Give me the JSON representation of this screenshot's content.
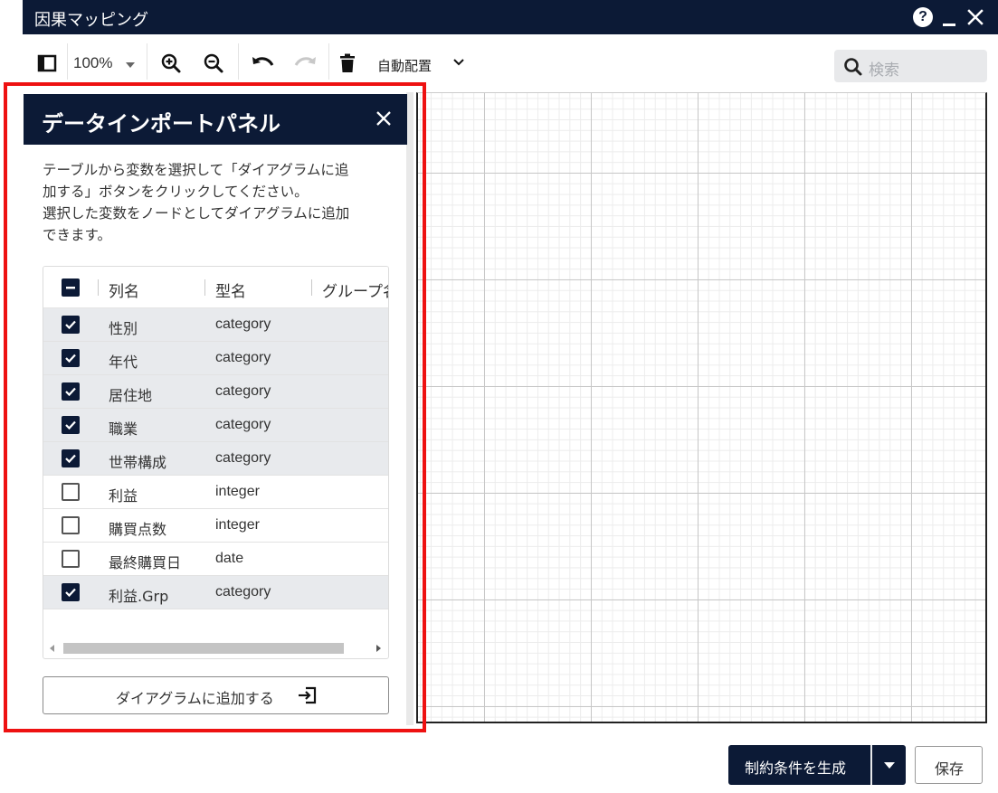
{
  "window": {
    "title": "因果マッピング"
  },
  "toolbar": {
    "zoom_level": "100%",
    "auto_layout_label": "自動配置",
    "search_placeholder": "検索"
  },
  "panel": {
    "title": "データインポートパネル",
    "description": [
      "テーブルから変数を選択して「ダイアグラムに追",
      "加する」ボタンをクリックしてください。",
      "選択した変数をノードとしてダイアグラムに追加",
      "できます。"
    ],
    "columns": [
      "列名",
      "型名",
      "グループ名"
    ],
    "header_checkbox_state": "indeterminate",
    "rows": [
      {
        "name": "性別",
        "type": "category",
        "checked": true
      },
      {
        "name": "年代",
        "type": "category",
        "checked": true
      },
      {
        "name": "居住地",
        "type": "category",
        "checked": true
      },
      {
        "name": "職業",
        "type": "category",
        "checked": true
      },
      {
        "name": "世帯構成",
        "type": "category",
        "checked": true
      },
      {
        "name": "利益",
        "type": "integer",
        "checked": false
      },
      {
        "name": "購買点数",
        "type": "integer",
        "checked": false
      },
      {
        "name": "最終購買日",
        "type": "date",
        "checked": false
      },
      {
        "name": "利益.Grp",
        "type": "category",
        "checked": true
      }
    ],
    "add_button_label": "ダイアグラムに追加する"
  },
  "footer": {
    "generate_label": "制約条件を生成",
    "save_label": "保存"
  },
  "colors": {
    "navy": "#0c1a36",
    "highlight": "#ee1111",
    "selected_row": "#e8eaed"
  }
}
